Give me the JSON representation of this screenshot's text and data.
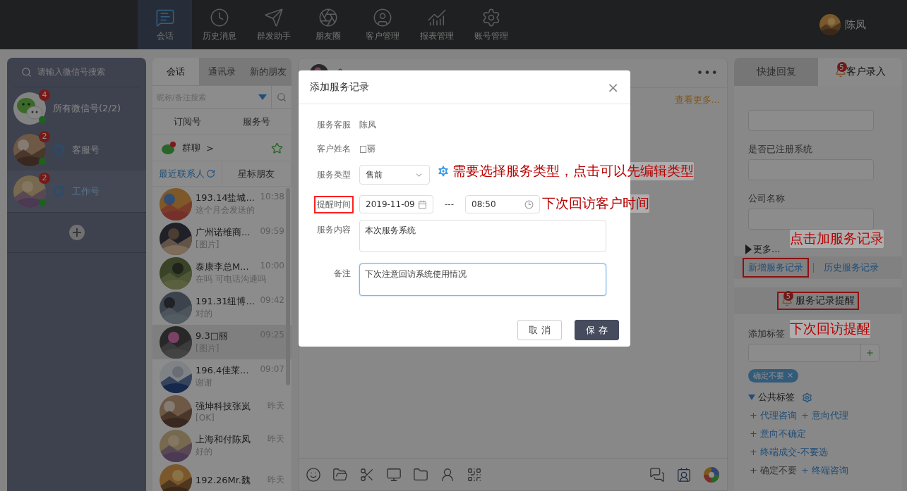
{
  "nav": {
    "tabs": [
      {
        "label": "会话",
        "selected": true
      },
      {
        "label": "历史消息",
        "selected": false
      },
      {
        "label": "群发助手",
        "selected": false
      },
      {
        "label": "朋友圈",
        "selected": false
      },
      {
        "label": "客户管理",
        "selected": false
      },
      {
        "label": "报表管理",
        "selected": false
      },
      {
        "label": "账号管理",
        "selected": false
      }
    ],
    "user": {
      "name": "陈凤"
    }
  },
  "accounts": {
    "search": {
      "placeholder": "请输入微信号搜索"
    },
    "items": [
      {
        "kind": "all",
        "label": "所有微信号(2/2)",
        "badge": "4",
        "selected": false
      },
      {
        "kind": "account",
        "label": "客服号",
        "badge": "2",
        "selected": false
      },
      {
        "kind": "account",
        "label": "工作号",
        "badge": "2",
        "selected": true
      }
    ]
  },
  "contacts": {
    "tabs": [
      {
        "label": "会话",
        "selected": true
      },
      {
        "label": "通讯录",
        "selected": false
      },
      {
        "label": "新的朋友",
        "selected": false
      }
    ],
    "search": {
      "placeholder": "昵称/备注搜索"
    },
    "categories": [
      "订阅号",
      "服务号"
    ],
    "group_chat": {
      "label": "群聊",
      "arrow": ">"
    },
    "subtabs": [
      {
        "label": "最近联系人",
        "selected": true
      },
      {
        "label": "星标朋友",
        "selected": false
      }
    ],
    "items": [
      {
        "name": "193.14盐城...",
        "time": "10:38",
        "preview": "这个月会发送的",
        "selected": false
      },
      {
        "name": "广州诺维商...",
        "time": "09:59",
        "preview": "[图片]",
        "selected": false
      },
      {
        "name": "泰康李总M...",
        "time": "10:00",
        "preview": "在吗 可电话沟通吗",
        "selected": false
      },
      {
        "name": "191.31纽博...",
        "time": "09:42",
        "preview": "对的",
        "selected": false
      },
      {
        "name": "9.3□丽",
        "time": "09:25",
        "preview": "[图片]",
        "selected": true
      },
      {
        "name": "196.4佳莱...",
        "time": "09:07",
        "preview": "谢谢",
        "selected": false
      },
      {
        "name": "强坤科技张岚",
        "time": "昨天",
        "preview": "[OK]",
        "selected": false
      },
      {
        "name": "上海和付陈凤",
        "time": "昨天",
        "preview": "好的",
        "selected": false
      },
      {
        "name": "192.26Mr.魏",
        "time": "昨天",
        "selected": false
      }
    ]
  },
  "chat": {
    "more_link": "查看更多...",
    "menu": "•••"
  },
  "dialog": {
    "title": "添加服务记录",
    "close": "×",
    "fields": [
      {
        "kind": "text",
        "label": "服务客服",
        "value": "陈凤",
        "highlighted": false
      },
      {
        "kind": "text",
        "label": "客户姓名",
        "value": "□丽",
        "highlighted": false
      },
      {
        "kind": "select",
        "label": "服务类型",
        "value": "售前",
        "highlighted": false
      },
      {
        "kind": "datetime",
        "label": "提醒时间",
        "date": "2019-11-09",
        "separator": "---",
        "time": "08:50",
        "highlighted": true
      },
      {
        "kind": "textarea",
        "label": "服务内容",
        "value": "本次服务系统",
        "focused": false,
        "highlighted": false
      },
      {
        "kind": "textarea",
        "label": "备注",
        "value": "下次注意回访系统使用情况",
        "focused": true,
        "highlighted": false
      }
    ],
    "buttons": [
      {
        "label": "取 消",
        "primary": false
      },
      {
        "label": "保 存",
        "primary": true
      }
    ]
  },
  "right_panel": {
    "tabs": [
      {
        "label": "快捷回复",
        "selected": false
      },
      {
        "label": "客户录入",
        "selected": true,
        "badge": "5"
      }
    ],
    "fields": [
      {
        "label": "是否已注册系统"
      },
      {
        "label": "公司名称"
      }
    ],
    "more": "更多...",
    "links": [
      {
        "label": "新增服务记录",
        "highlighted": true
      },
      {
        "label": "历史服务记录",
        "highlighted": false
      }
    ],
    "reminder": {
      "label": "服务记录提醒",
      "badge": "5",
      "highlighted": true
    },
    "tag_label": "添加标签",
    "chosen_tags": [
      {
        "label": "确定不要",
        "remove": "×"
      }
    ],
    "public_tags": {
      "title": "公共标签",
      "rows": [
        [
          {
            "label": "+ 代理咨询",
            "selected": false
          },
          {
            "label": "+ 意向代理",
            "selected": false
          }
        ],
        [
          {
            "label": "+ 意向不确定",
            "selected": false
          }
        ],
        [
          {
            "label": "+ 终端成交-不要选",
            "selected": false
          }
        ],
        [
          {
            "label": "+ 确定不要",
            "selected": true
          },
          {
            "label": "+ 终端咨询",
            "selected": false
          }
        ]
      ]
    }
  },
  "annotations": [
    {
      "kind": "gear-note",
      "text": "需要选择服务类型，点击可以先编辑类型"
    },
    {
      "kind": "note",
      "text": "下次回访客户时间"
    },
    {
      "kind": "note",
      "text": "点击加服务记录"
    },
    {
      "kind": "note",
      "text": "下次回访提醒"
    }
  ]
}
